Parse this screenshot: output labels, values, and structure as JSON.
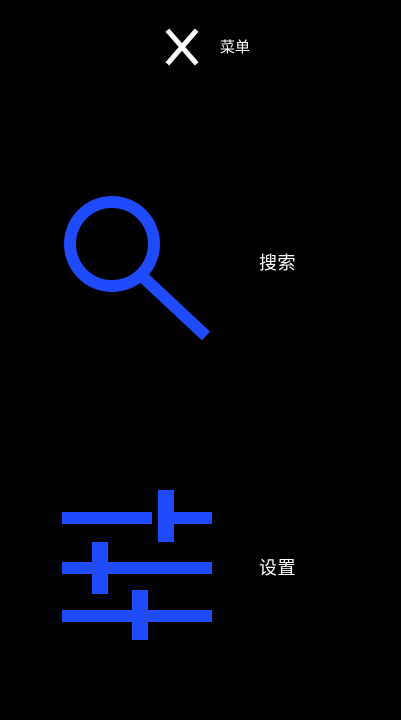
{
  "header": {
    "close_icon": "close-icon",
    "title": "菜单"
  },
  "menu": {
    "items": [
      {
        "icon": "search-icon",
        "label": "搜索"
      },
      {
        "icon": "sliders-icon",
        "label": "设置"
      }
    ]
  },
  "colors": {
    "background": "#000000",
    "icon_blue": "#1F4BFF",
    "text": "#FFFFFF"
  }
}
